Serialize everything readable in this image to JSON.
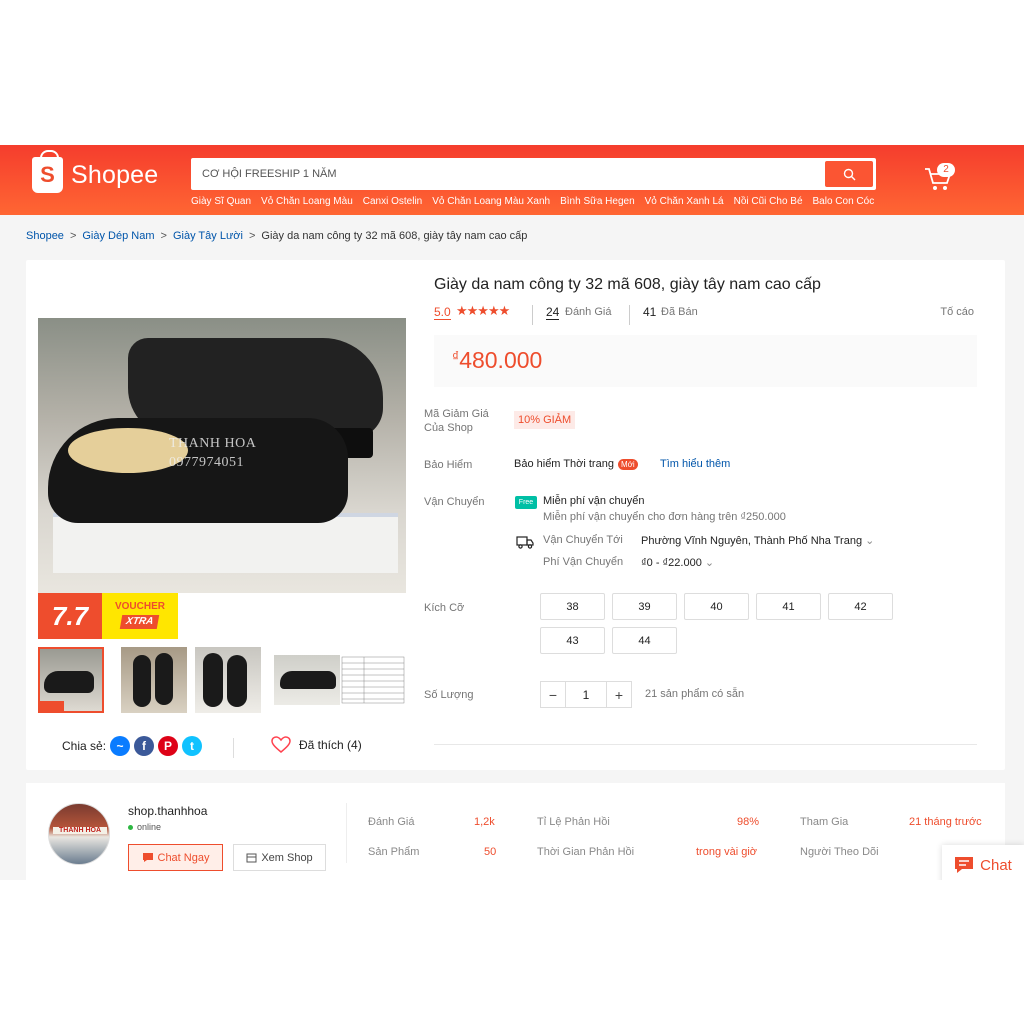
{
  "header": {
    "logo_text": "Shopee",
    "logo_letter": "S",
    "search_text": "CƠ HỘI FREESHIP 1 NĂM",
    "cart_count": "2",
    "keywords": [
      "Giày Sĩ Quan",
      "Vỏ Chăn Loang Màu",
      "Canxi Ostelin",
      "Vỏ Chăn Loang Màu Xanh",
      "Bình Sữa Hegen",
      "Vỏ Chăn Xanh Lá",
      "Nồi Cũi Cho Bé",
      "Balo Con Cóc"
    ]
  },
  "breadcrumb": {
    "items": [
      "Shopee",
      "Giày Dép Nam",
      "Giày Tây Lười"
    ],
    "current": "Giày da nam công ty 32 mã 608, giày tây nam cao cấp"
  },
  "product": {
    "title": "Giày da nam công ty 32 mã 608, giày tây nam cao cấp",
    "rating": "5.0",
    "stars": "★★★★★",
    "reviews_count": "24",
    "reviews_label": "Đánh Giá",
    "sold_count": "41",
    "sold_label": "Đã Bán",
    "report_label": "Tố cáo",
    "price_currency": "₫",
    "price": "480.000",
    "watermark_line1": "THANH HOA",
    "watermark_line2": "0977974051",
    "promo_77": "7.7",
    "promo_voucher": "VOUCHER",
    "promo_xtra": "XTRA"
  },
  "voucher": {
    "label_line1": "Mã Giảm Giá",
    "label_line2": "Của Shop",
    "tag": "10% GIẢM"
  },
  "insurance": {
    "label": "Bảo Hiểm",
    "text": "Bảo hiểm Thời trang",
    "badge": "Mới",
    "link": "Tìm hiểu thêm"
  },
  "shipping": {
    "label": "Vận Chuyển",
    "free_icon": "Free",
    "free_title": "Miễn phí vận chuyển",
    "free_sub": "Miễn phí vận chuyển cho đơn hàng trên ₫250.000",
    "to_label": "Vận Chuyển Tới",
    "to_value": "Phường Vĩnh Nguyên, Thành Phố Nha Trang",
    "fee_label": "Phí Vận Chuyển",
    "fee_value": "₫0 - ₫22.000"
  },
  "size": {
    "label": "Kích Cỡ",
    "options": [
      "38",
      "39",
      "40",
      "41",
      "42",
      "43",
      "44"
    ]
  },
  "quantity": {
    "label": "Số Lượng",
    "minus": "−",
    "value": "1",
    "plus": "+",
    "available": "21 sản phẩm có sẵn"
  },
  "share": {
    "label": "Chia sẻ:",
    "favorite": "Đã thích (4)"
  },
  "shop": {
    "name": "shop.thanhhoa",
    "status": "online",
    "avatar_text": "THANH HOA",
    "chat_button": "Chat Ngay",
    "view_button": "Xem Shop",
    "stats": [
      {
        "label": "Đánh Giá",
        "value": "1,2k"
      },
      {
        "label": "Tỉ Lệ Phản Hồi",
        "value": "98%"
      },
      {
        "label": "Tham Gia",
        "value": "21 tháng trước"
      },
      {
        "label": "Sản Phẩm",
        "value": "50"
      },
      {
        "label": "Thời Gian Phản Hồi",
        "value": "trong vài giờ"
      },
      {
        "label": "Người Theo Dõi",
        "value": ""
      }
    ]
  },
  "chat_float": {
    "label": "Chat"
  },
  "colors": {
    "brand": "#ee4d2d",
    "link": "#0055aa"
  }
}
